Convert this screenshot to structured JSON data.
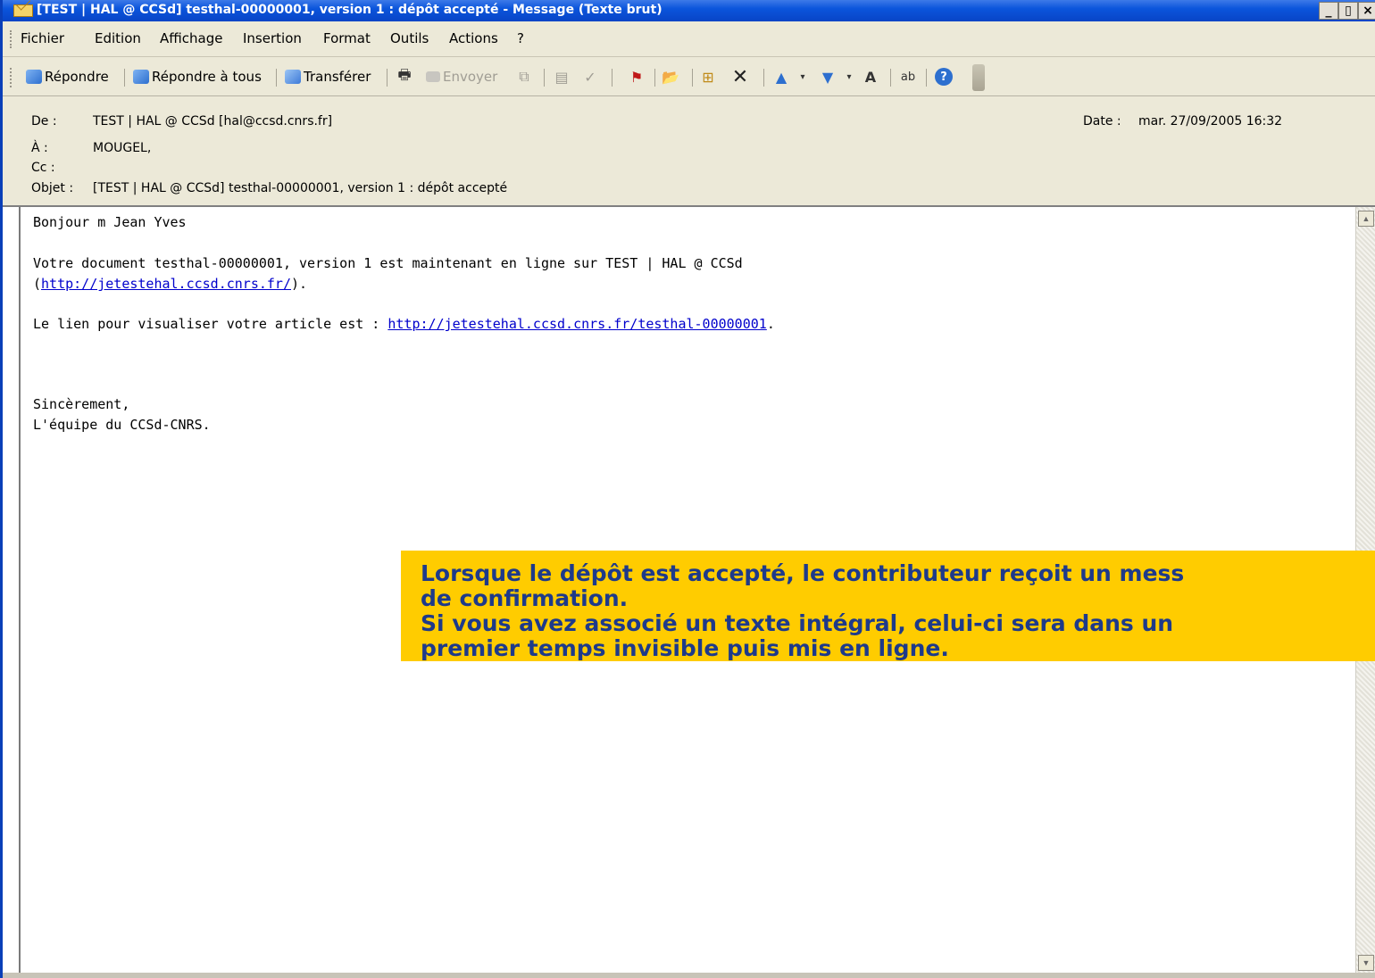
{
  "window": {
    "title": "[TEST | HAL @ CCSd] testhal-00000001, version 1 : dépôt accepté - Message (Texte brut)",
    "controls": {
      "minimize": "_",
      "restore": "▯",
      "close": "×"
    }
  },
  "menu": [
    "Fichier",
    "Edition",
    "Affichage",
    "Insertion",
    "Format",
    "Outils",
    "Actions",
    "?"
  ],
  "toolbar": {
    "reply": "Répondre",
    "reply_all": "Répondre à tous",
    "forward": "Transférer",
    "send": "Envoyer"
  },
  "header": {
    "from_label": "De :",
    "from_value": "TEST | HAL @ CCSd [hal@ccsd.cnrs.fr]",
    "to_label": "À :",
    "to_value": "MOUGEL,",
    "cc_label": "Cc :",
    "subject_label": "Objet :",
    "subject_value": "[TEST | HAL @ CCSd] testhal-00000001, version 1 : dépôt accepté",
    "date_label": "Date :",
    "date_value": "mar. 27/09/2005 16:32"
  },
  "body": {
    "greeting": "Bonjour m Jean Yves",
    "line1": "Votre document testhal-00000001, version 1 est maintenant en ligne sur TEST | HAL @ CCSd",
    "line2_open": "(",
    "line2_link": "http://jetestehal.ccsd.cnrs.fr/",
    "line2_close": ").",
    "line3_text": "Le lien pour visualiser votre article est : ",
    "line3_link": "http://jetestehal.ccsd.cnrs.fr/testhal-00000001",
    "line3_end": ".",
    "closing": "Sincèrement,",
    "signature": "L'équipe du CCSd-CNRS."
  },
  "callout": {
    "line1": "Lorsque le dépôt est accepté, le contributeur reçoit un mess",
    "line2": "de confirmation.",
    "line3": "Si vous avez associé un texte intégral, celui-ci sera dans un",
    "line4": "premier temps invisible puis mis en ligne."
  }
}
